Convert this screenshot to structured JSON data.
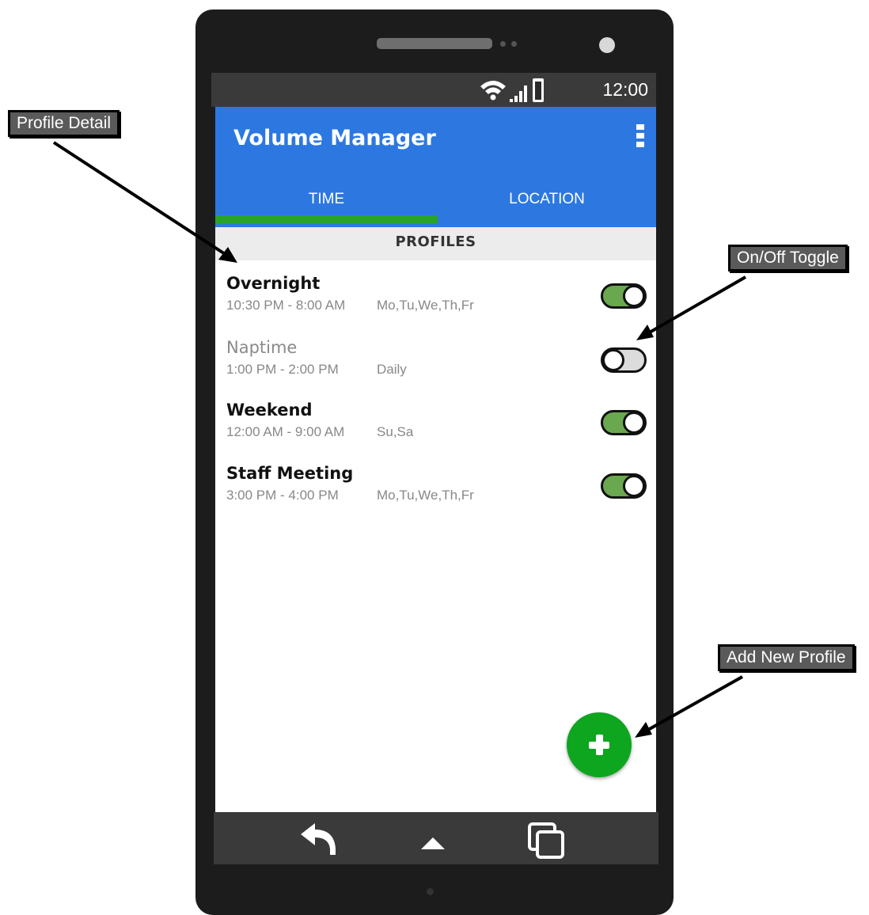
{
  "status_bar": {
    "time": "12:00"
  },
  "app_bar": {
    "title": "Volume Manager",
    "tabs": [
      {
        "label": "TIME",
        "selected": true
      },
      {
        "label": "LOCATION",
        "selected": false
      }
    ]
  },
  "section_header": "PROFILES",
  "profiles": [
    {
      "name": "Overnight",
      "time": "10:30 PM - 8:00 AM",
      "days": "Mo,Tu,We,Th,Fr",
      "enabled": true
    },
    {
      "name": "Naptime",
      "time": "1:00 PM - 2:00 PM",
      "days": "Daily",
      "enabled": false
    },
    {
      "name": "Weekend",
      "time": "12:00 AM - 9:00 AM",
      "days": "Su,Sa",
      "enabled": true
    },
    {
      "name": "Staff Meeting",
      "time": "3:00 PM - 4:00 PM",
      "days": "Mo,Tu,We,Th,Fr",
      "enabled": true
    }
  ],
  "annotations": {
    "profile_detail": "Profile Detail",
    "toggle": "On/Off Toggle",
    "add_profile": "Add New Profile"
  },
  "icons": {
    "fab": "plus-icon",
    "nav": [
      "back-icon",
      "home-icon",
      "recents-icon"
    ],
    "status": [
      "wifi-icon",
      "signal-icon",
      "battery-icon"
    ],
    "menu": "overflow-menu-icon"
  },
  "colors": {
    "app_bar": "#2d78e0",
    "tab_indicator": "#2aa32a",
    "fab": "#0ea51f",
    "toggle_on": "#6aa84f",
    "toggle_off": "#dcdcdc"
  }
}
